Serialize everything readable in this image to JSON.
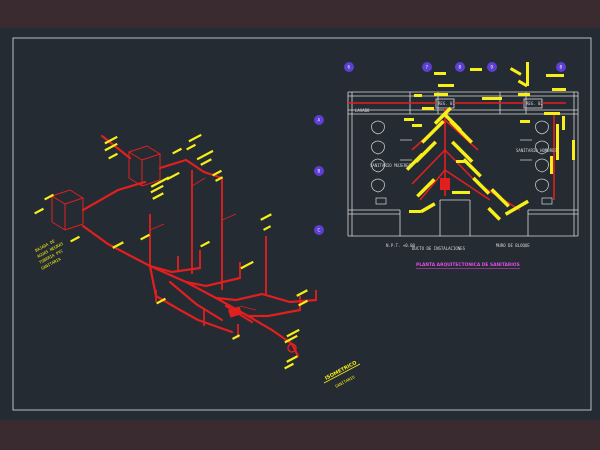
{
  "drawing": {
    "colors": {
      "background": "#242b33",
      "outer_band": "#3a2b31",
      "frame": "#c9ced6",
      "pipe_red": "#e21f1f",
      "text_yellow": "#f7ef19",
      "title_magenta": "#e24ce6",
      "grid_bubble": "#5d3fd3",
      "walls": "#d8d8d8"
    },
    "plan": {
      "title": "PLANTA ARQUITECTONICA DE SANITARIOS",
      "note_left": "LAVABO",
      "note_shafts": "DUCTO DE INSTALACIONES",
      "note_rooms": "SANITARIO HOMBRES",
      "note_rooms2": "SANITARIO MUJERES",
      "note_floor": "N.P.T. +0.00",
      "note_wall": "MURO DE BLOQUE",
      "box_labels": [
        "REG. 01",
        "REG. 02"
      ],
      "bubbles_top": [
        "7",
        "8",
        "9",
        "8"
      ],
      "bubbles_side": [
        "A",
        "B",
        "C"
      ],
      "bubble_left_top": "6"
    },
    "iso": {
      "title": "ISOMETRICO",
      "subtitle": "SANITARIO",
      "legend_lines": [
        "BAJADA DE",
        "AGUAS NEGRAS",
        "TUBERIA PVC",
        "SANITARIA"
      ]
    }
  }
}
